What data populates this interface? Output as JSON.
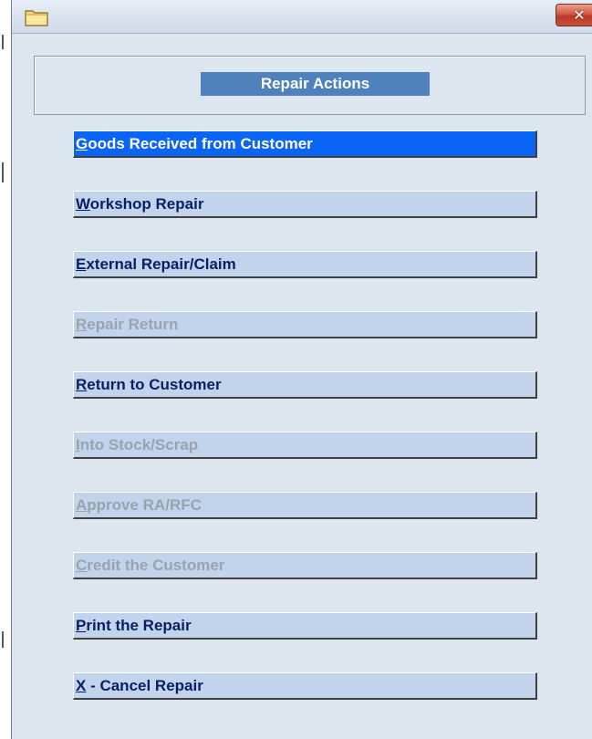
{
  "window": {
    "icon": "folder-icon",
    "close_icon": "close-icon",
    "close_symbol": "✕",
    "close_color": "#c9503a"
  },
  "panel": {
    "title": "Repair Actions",
    "title_background": "#4f81bd"
  },
  "actions": [
    {
      "mnemonic": "G",
      "rest": "oods Received from Customer",
      "state": "selected"
    },
    {
      "mnemonic": "W",
      "rest": "orkshop Repair",
      "state": "enabled"
    },
    {
      "mnemonic": "E",
      "rest": "xternal Repair/Claim",
      "state": "enabled"
    },
    {
      "mnemonic": "R",
      "rest": "epair Return",
      "state": "disabled"
    },
    {
      "mnemonic": "R",
      "rest": "eturn to Customer",
      "state": "enabled"
    },
    {
      "mnemonic": "I",
      "rest": "nto Stock/Scrap",
      "state": "disabled"
    },
    {
      "mnemonic": "A",
      "rest": "pprove RA/RFC",
      "state": "disabled"
    },
    {
      "mnemonic": "C",
      "rest": "redit the Customer",
      "state": "disabled"
    },
    {
      "mnemonic": "P",
      "rest": "rint the Repair",
      "state": "enabled"
    },
    {
      "mnemonic": "X",
      "rest": " - Cancel Repair",
      "state": "enabled"
    }
  ],
  "colors": {
    "button_face": "#c2d4ec",
    "button_selected": "#0a64f5",
    "text_enabled": "#0a1e63",
    "text_disabled": "#9aa3ad",
    "background": "#dde6ee"
  }
}
